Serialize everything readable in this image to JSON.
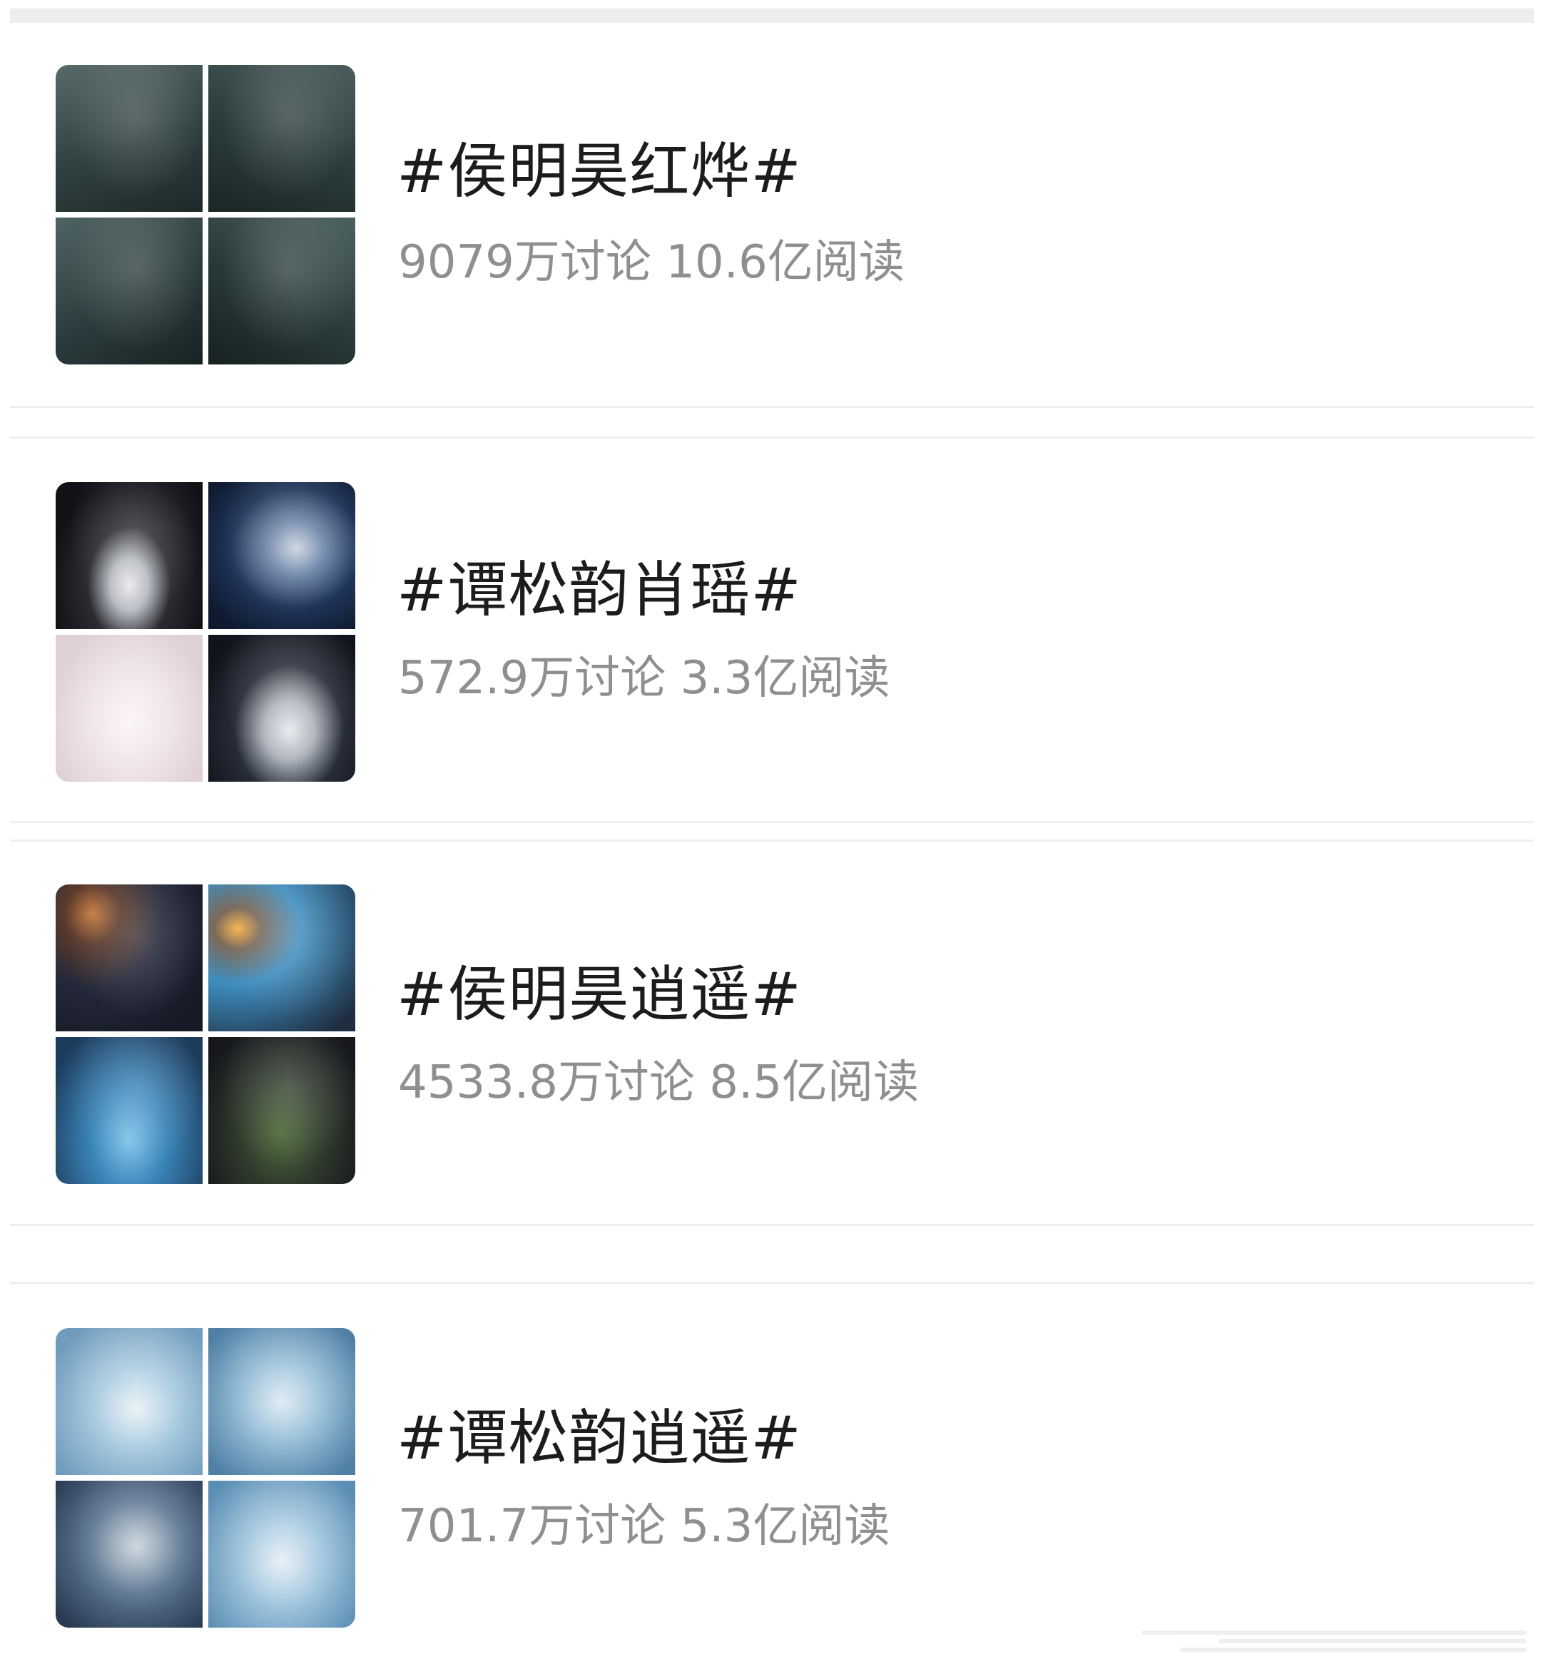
{
  "topics": [
    {
      "title": "#侯明昊红烨#",
      "stats": "9079万讨论 10.6亿阅读",
      "thumbnail_colors": [
        "#3d5150",
        "#2e4141",
        "#34484a",
        "#2b3e3f"
      ]
    },
    {
      "title": "#谭松韵肖瑶#",
      "stats": "572.9万讨论 3.3亿阅读",
      "thumbnail_colors": [
        "#1a1d22",
        "#1e2f4e",
        "#f0e6ea",
        "#151a24"
      ]
    },
    {
      "title": "#侯明昊逍遥#",
      "stats": "4533.8万讨论 8.5亿阅读",
      "thumbnail_colors": [
        "#2c3040",
        "#3f8ab8",
        "#3b7ca6",
        "#2f3a2c"
      ]
    },
    {
      "title": "#谭松韵逍遥#",
      "stats": "701.7万讨论 5.3亿阅读",
      "thumbnail_colors": [
        "#9fc4dc",
        "#8ab5d1",
        "#6c8aa8",
        "#8fb8d3"
      ]
    }
  ]
}
